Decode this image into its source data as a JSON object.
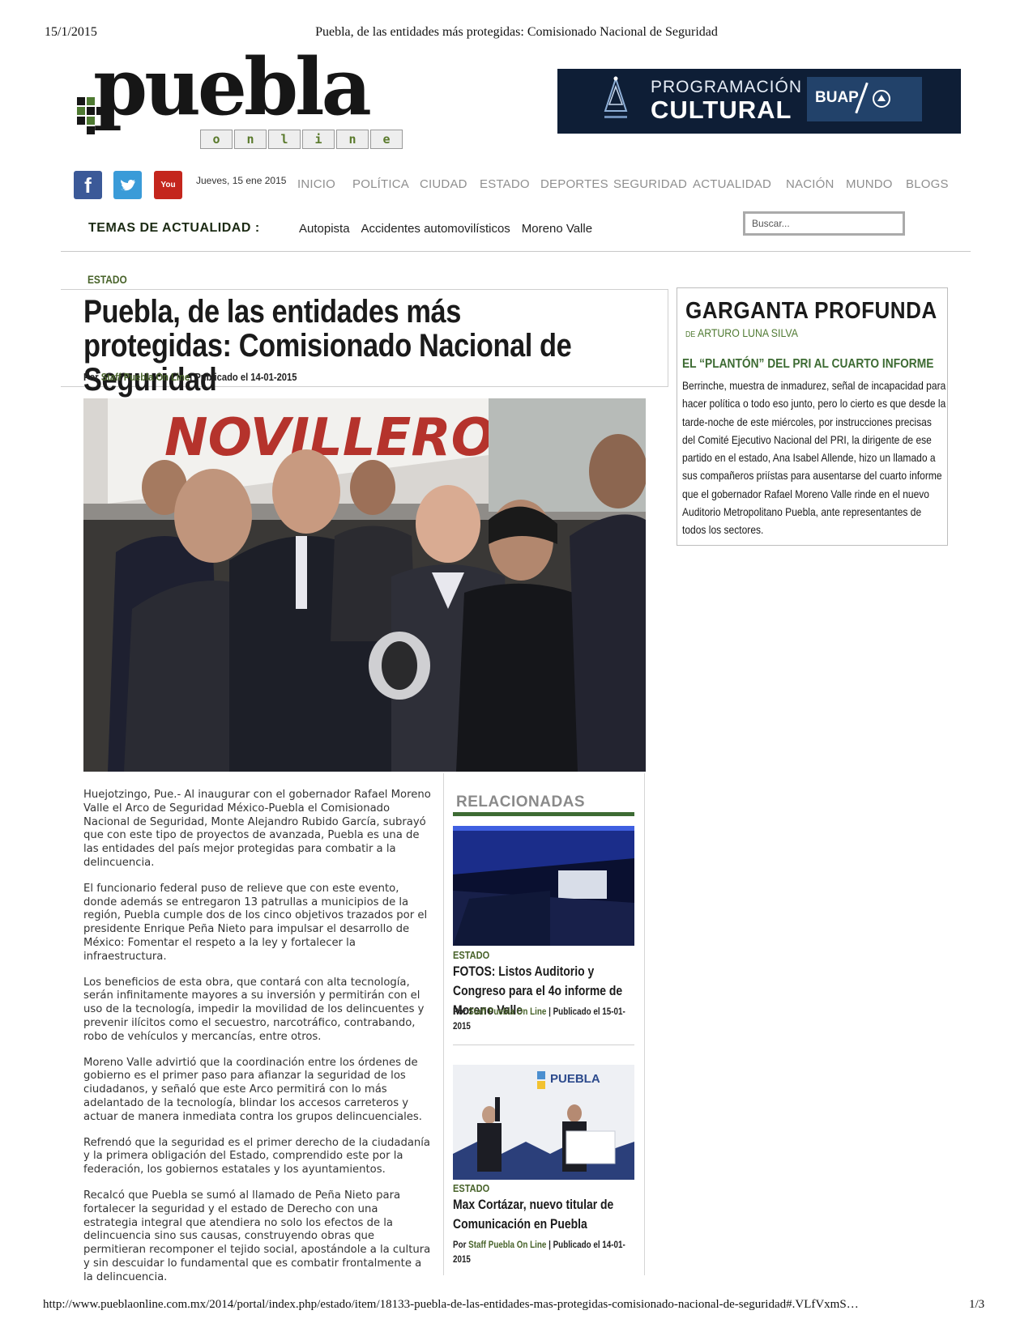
{
  "print": {
    "date": "15/1/2015",
    "title": "Puebla, de las entidades más protegidas: Comisionado Nacional de Seguridad",
    "url": "http://www.pueblaonline.com.mx/2014/portal/index.php/estado/item/18133-puebla-de-las-entidades-mas-protegidas-comisionado-nacional-de-seguridad#.VLfVxmS…",
    "page": "1/3"
  },
  "logo": {
    "word": "puebla",
    "online_letters": [
      "o",
      "n",
      "l",
      "i",
      "n",
      "e"
    ]
  },
  "banner": {
    "line1": "PROGRAMACIÓN",
    "line2": "CULTURAL",
    "brand": "BUAP"
  },
  "header": {
    "social": {
      "facebook": "f",
      "twitter": "twitter-bird-icon",
      "youtube": "You Tube"
    },
    "date": "Jueves, 15 ene 2015",
    "nav": [
      "INICIO",
      "POLÍTICA",
      "CIUDAD",
      "ESTADO",
      "DEPORTES",
      "SEGURIDAD",
      "ACTUALIDAD",
      "NACIÓN",
      "MUNDO",
      "BLOGS"
    ],
    "temas_label": "TEMAS DE ACTUALIDAD :",
    "temas": [
      "Autopista",
      "Accidentes automovilísticos",
      "Moreno Valle"
    ],
    "search_placeholder": "Buscar..."
  },
  "article": {
    "section": "ESTADO",
    "title": "Puebla, de las entidades más protegidas: Comisionado Nacional de Seguridad",
    "by_prefix": "Por",
    "author": "Staff Puebla On Line",
    "published": "| Publicado el 14-01-2015",
    "paragraphs": [
      "Huejotzingo, Pue.-  Al inaugurar con el gobernador Rafael Moreno Valle el Arco de Seguridad México-Puebla el Comisionado Nacional de Seguridad, Monte Alejandro Rubido García, subrayó que con este tipo de proyectos de avanzada, Puebla es una de las entidades del país mejor protegidas para combatir a la delincuencia.",
      "El funcionario federal puso de relieve que con este evento, donde además se entregaron 13 patrullas a municipios de la región, Puebla cumple dos de los cinco objetivos trazados por el presidente Enrique Peña Nieto para impulsar el desarrollo de México: Fomentar el respeto a la ley y fortalecer la infraestructura.",
      "Los beneficios de esta obra, que contará con alta tecnología, serán infinitamente mayores a su inversión y permitirán con el uso de la tecnología, impedir la movilidad de los delincuentes y prevenir ilícitos como el secuestro, narcotráfico, contrabando, robo de vehículos y mercancías, entre otros.",
      "Moreno Valle advirtió que la coordinación entre los órdenes de gobierno es el primer paso para afianzar la seguridad de los ciudadanos, y señaló que este Arco permitirá con lo más adelantado de la tecnología, blindar los accesos carreteros y actuar de manera inmediata contra los grupos delincuenciales.",
      "Refrendó que la seguridad es el primer derecho de la ciudadanía y la primera obligación del Estado, comprendido este por la federación, los gobiernos estatales y los ayuntamientos.",
      "Recalcó que Puebla se sumó al llamado de Peña Nieto para fortalecer la seguridad y el estado de Derecho con una estrategia integral que atendiera no solo los efectos de la delincuencia sino sus causas, construyendo obras que permitieran recomponer el tejido social, apostándole a la cultura y sin descuidar lo fundamental que es combatir frontalmente a la delincuencia."
    ],
    "photo_sign": "NOVILLERO"
  },
  "related": {
    "title": "RELACIONADAS",
    "items": [
      {
        "section": "ESTADO",
        "headline": "FOTOS: Listos Auditorio y Congreso para el 4o informe de Moreno Valle",
        "by_prefix": "Por",
        "author": "Staff Puebla On Line",
        "published": "| Publicado el 15-01-2015"
      },
      {
        "section": "ESTADO",
        "headline": "Max Cortázar, nuevo titular de Comunicación en Puebla",
        "by_prefix": "Por",
        "author": "Staff Puebla On Line",
        "published": "| Publicado el 14-01-2015",
        "image_sign": "PUEBLA"
      }
    ]
  },
  "column": {
    "title": "GARGANTA PROFUNDA",
    "author_prefix": "DE",
    "author": "ARTURO LUNA SILVA",
    "headline": "EL “PLANTÓN” DEL PRI AL CUARTO INFORME",
    "text": "Berrinche, muestra de inmadurez, señal de incapacidad para hacer política o todo eso junto, pero lo cierto es que desde la tarde-noche de este miércoles, por instrucciones precisas del Comité Ejecutivo Nacional del PRI, la dirigente de ese partido en el estado, Ana Isabel Allende, hizo un llamado a sus compañeros priístas para ausentarse del cuarto informe que el gobernador Rafael Moreno Valle rinde en el nuevo Auditorio Metropolitano Puebla, ante representantes de todos los sectores."
  }
}
